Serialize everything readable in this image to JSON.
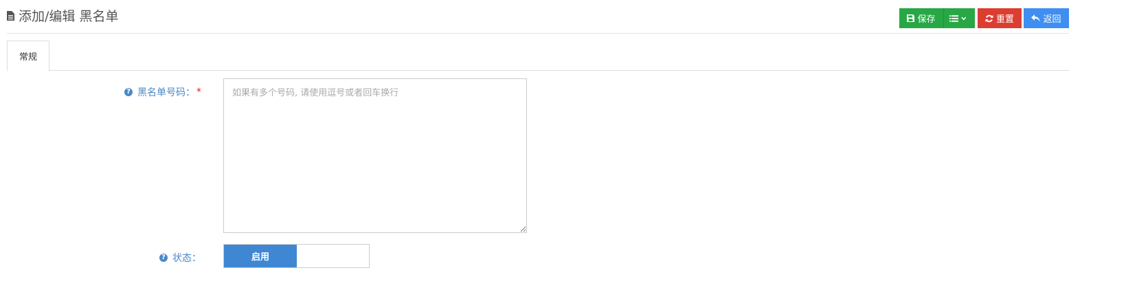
{
  "header": {
    "title": "添加/编辑 黑名单",
    "icon": "file-text-icon"
  },
  "toolbar": {
    "save_label": "保存",
    "reset_label": "重置",
    "back_label": "返回",
    "colors": {
      "save": "#28a745",
      "reset": "#dc3d31",
      "back": "#3f8ef1"
    }
  },
  "tabs": [
    {
      "label": "常规",
      "active": true
    }
  ],
  "form": {
    "numbers": {
      "label": "黑名单号码：",
      "required_mark": "*",
      "placeholder": "如果有多个号码, 请使用逗号或者回车换行",
      "value": ""
    },
    "status": {
      "label": "状态：",
      "on_label": "启用",
      "value": "启用"
    }
  }
}
